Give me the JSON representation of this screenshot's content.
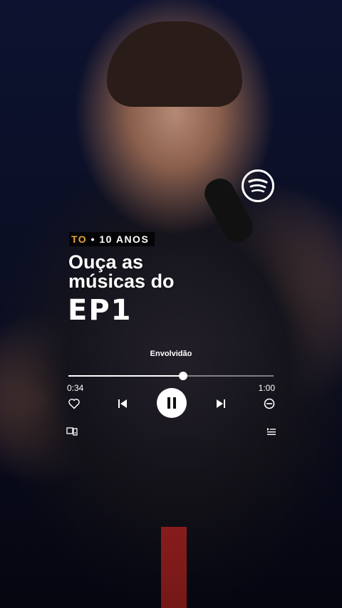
{
  "tagline": {
    "accent": "TO",
    "separator": "•",
    "rest": "10 ANOS"
  },
  "title": {
    "line1": "Ouça as",
    "line2": "músicas do"
  },
  "ep_label": "EP1",
  "player": {
    "song_title": "Envolvidão",
    "elapsed": "0:34",
    "duration": "1:00",
    "progress_fraction": 0.56
  },
  "icons": {
    "logo": "spotify-icon",
    "like": "heart-icon",
    "prev": "skip-previous-icon",
    "playpause": "pause-icon",
    "next": "skip-next-icon",
    "hide": "block-icon",
    "device": "device-icon",
    "queue": "queue-icon"
  },
  "colors": {
    "accent": "#e8a53a",
    "text": "#ffffff"
  }
}
